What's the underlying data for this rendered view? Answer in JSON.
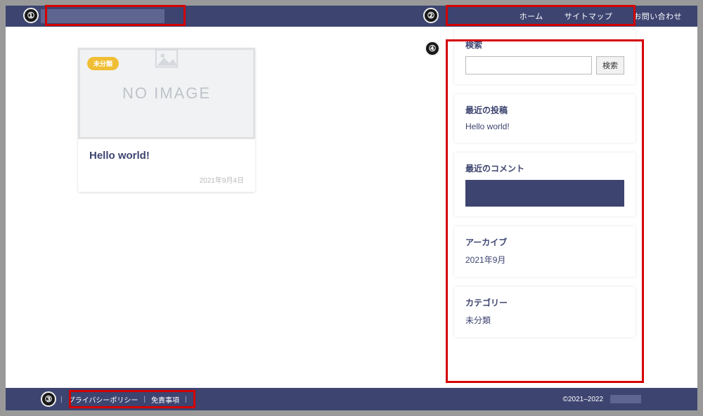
{
  "header": {
    "nav": [
      {
        "label": "ホーム"
      },
      {
        "label": "サイトマップ"
      },
      {
        "label": "お問い合わせ"
      }
    ]
  },
  "post": {
    "badge": "未分類",
    "no_image_label": "NO IMAGE",
    "title": "Hello world!",
    "date": "2021年9月4日"
  },
  "sidebar": {
    "search": {
      "title": "検索",
      "button": "検索",
      "placeholder": ""
    },
    "recent_posts": {
      "title": "最近の投稿",
      "items": [
        "Hello world!"
      ]
    },
    "recent_comments": {
      "title": "最近のコメント"
    },
    "archive": {
      "title": "アーカイブ",
      "items": [
        "2021年9月"
      ]
    },
    "category": {
      "title": "カテゴリー",
      "items": [
        "未分類"
      ]
    }
  },
  "footer": {
    "links": [
      "プライバシーポリシー",
      "免責事項"
    ],
    "copyright": "©2021–2022"
  },
  "annotations": {
    "n1": "①",
    "n2": "②",
    "n3": "③",
    "n4": "④"
  }
}
